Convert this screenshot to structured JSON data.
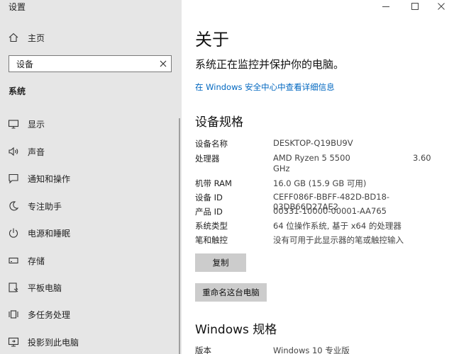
{
  "window": {
    "title": "设置",
    "controls": [
      "minimize-icon",
      "maximize-icon",
      "close-icon"
    ]
  },
  "sidebar": {
    "home": {
      "label": "主页",
      "icon": "home-icon"
    },
    "search": {
      "value": "设备",
      "icon": "close-icon"
    },
    "section_label": "系统",
    "items": [
      {
        "label": "显示",
        "icon": "display-icon"
      },
      {
        "label": "声音",
        "icon": "speaker-icon"
      },
      {
        "label": "通知和操作",
        "icon": "notification-icon"
      },
      {
        "label": "专注助手",
        "icon": "moon-icon"
      },
      {
        "label": "电源和睡眠",
        "icon": "power-icon"
      },
      {
        "label": "存储",
        "icon": "storage-icon"
      },
      {
        "label": "平板电脑",
        "icon": "tablet-icon"
      },
      {
        "label": "多任务处理",
        "icon": "multitask-icon"
      },
      {
        "label": "投影到此电脑",
        "icon": "project-icon"
      }
    ]
  },
  "main": {
    "title": "关于",
    "protection_status": "系统正在监控并保护你的电脑。",
    "security_link": "在 Windows 安全中心中查看详细信息",
    "device_specs": {
      "heading": "设备规格",
      "rows": [
        {
          "key": "设备名称",
          "value": "DESKTOP-Q19BU9V"
        },
        {
          "key": "处理器",
          "value": "AMD Ryzen 5 5500",
          "extra": "3.60",
          "value_line2": "GHz"
        },
        {
          "key": "机带 RAM",
          "value": "16.0 GB (15.9 GB 可用)"
        },
        {
          "key": "设备 ID",
          "value": "CEFF086F-BBFF-482D-BD18-03DB66D27AE2"
        },
        {
          "key": "产品 ID",
          "value": "00331-10000-00001-AA765"
        },
        {
          "key": "系统类型",
          "value": "64 位操作系统, 基于 x64 的处理器"
        },
        {
          "key": "笔和触控",
          "value": "没有可用于此显示器的笔或触控输入"
        }
      ],
      "copy_button": "复制",
      "rename_button": "重命名这台电脑"
    },
    "windows_specs": {
      "heading": "Windows 规格",
      "rows": [
        {
          "key": "版本",
          "value": "Windows 10 专业版"
        }
      ]
    }
  }
}
